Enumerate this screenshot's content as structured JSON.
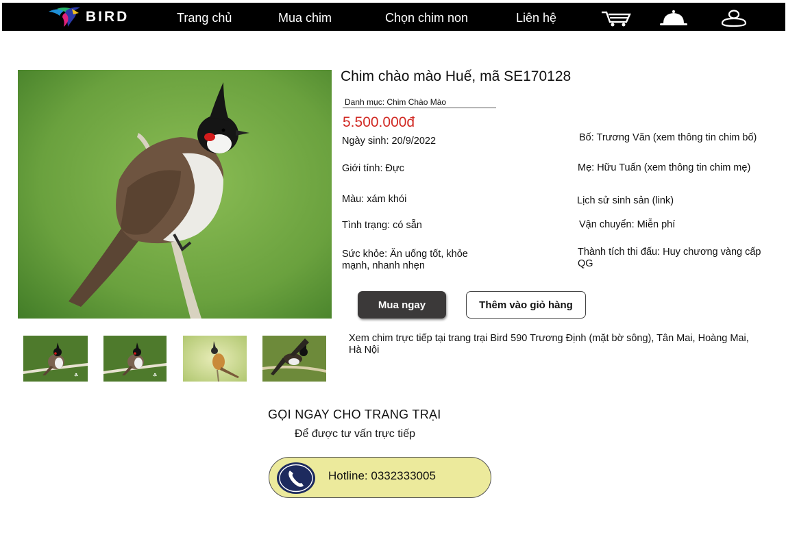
{
  "nav": {
    "logo_text": "BIRD",
    "links": [
      "Trang chủ",
      "Mua chim",
      "Chọn chim non",
      "Liên hệ"
    ],
    "icons": [
      "cart-icon",
      "bell-icon",
      "user-icon"
    ]
  },
  "product": {
    "title": "Chim chào mào Huế, mã SE170128",
    "category": "Danh mục: Chim Chào Mào",
    "price": "5.500.000đ",
    "left_info": [
      "Ngày sinh: 20/9/2022",
      "Giới tính: Đực",
      "Màu: xám khói",
      "Tình trạng: có sẵn",
      "Sức khỏe: Ăn uống tốt, khỏe mạnh, nhanh nhẹn"
    ],
    "right_info": [
      "Bố: Trương Văn (xem thông tin chim bố)",
      "Mẹ: Hữu Tuấn (xem thông tin chim mẹ)",
      "Lịch sử sinh sản (link)",
      "Vận chuyển: Miễn phí",
      "Thành tích thi đấu: Huy chương vàng cấp QG"
    ]
  },
  "buttons": {
    "buy": "Mua ngay",
    "add_cart": "Thêm vào giỏ hàng"
  },
  "visit_text": "Xem chim trực tiếp tại trang trại Bird 590 Trương Định (mặt bờ sông), Tân Mai, Hoàng Mai, Hà Nội",
  "call": {
    "title": "GỌI NGAY CHO TRANG TRẠI",
    "subtitle": "Để được tư vấn trực tiếp",
    "hotline": "Hotline: 0332333005"
  }
}
